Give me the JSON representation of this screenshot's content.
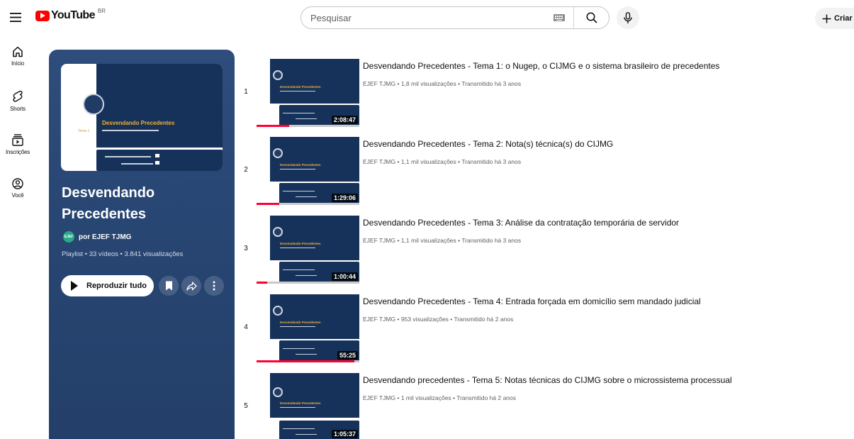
{
  "header": {
    "logo_text": "YouTube",
    "region": "BR",
    "search_placeholder": "Pesquisar",
    "create_label": "Criar"
  },
  "nav": [
    {
      "label": "Início",
      "icon": "home-icon"
    },
    {
      "label": "Shorts",
      "icon": "shorts-icon"
    },
    {
      "label": "Inscrições",
      "icon": "subscriptions-icon"
    },
    {
      "label": "Você",
      "icon": "you-icon"
    }
  ],
  "playlist": {
    "title": "Desvendando Precedentes",
    "owner_avatar_text": "EJEF",
    "owner_prefix": "por",
    "owner_name": "EJEF TJMG",
    "meta": "Playlist • 33 vídeos • 3.841 visualizações",
    "play_all_label": "Reproduzir tudo",
    "thumb_title": "Desvendando Precedentes",
    "thumb_topic": "Tema 1",
    "colors": {
      "panel": "#2a4876",
      "accent_gold": "#f0b232"
    }
  },
  "videos": [
    {
      "index": "1",
      "title": "Desvendando Precedentes - Tema 1: o Nugep, o CIJMG e o sistema brasileiro de precedentes",
      "meta": "EJEF TJMG • 1,8 mil visualizações • Transmitido há 3 anos",
      "duration": "2:08:47",
      "progress": 0.32,
      "thumb_title": "Desvendando Precedentes"
    },
    {
      "index": "2",
      "title": "Desvendando Precedentes - Tema 2: Nota(s) técnica(s) do CIJMG",
      "meta": "EJEF TJMG • 1,1 mil visualizações • Transmitido há 3 anos",
      "duration": "1:29:06",
      "progress": 0.22,
      "thumb_title": "Desvendando Precedentes"
    },
    {
      "index": "3",
      "title": "Desvendando Precedentes - Tema 3: Análise da contratação temporária de servidor",
      "meta": "EJEF TJMG • 1,1 mil visualizações • Transmitido há 3 anos",
      "duration": "1:00:44",
      "progress": 0.1,
      "thumb_title": "Desvendando Precedentes"
    },
    {
      "index": "4",
      "title": "Desvendando Precedentes - Tema 4: Entrada forçada em domicílio sem mandado judicial",
      "meta": "EJEF TJMG • 953 visualizações • Transmitido há 2 anos",
      "duration": "55:25",
      "progress": 0.95,
      "thumb_title": "Desvendando Precedentes"
    },
    {
      "index": "5",
      "title": "Desvendando precedentes - Tema 5: Notas técnicas do CIJMG sobre o microssistema processual",
      "meta": "EJEF TJMG • 1 mil visualizações • Transmitido há 2 anos",
      "duration": "1:05:37",
      "progress": 0.0,
      "thumb_title": "Desvendando Precedentes"
    }
  ]
}
